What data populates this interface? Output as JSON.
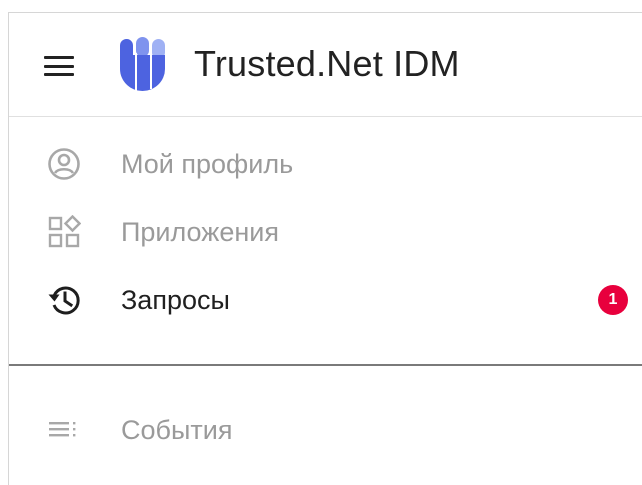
{
  "header": {
    "title": "Trusted.Net IDM",
    "menu_icon": "hamburger-menu-icon",
    "logo": "trusted-net-logo"
  },
  "nav": {
    "items": [
      {
        "label": "Мой профиль",
        "icon": "profile-icon",
        "state": "inactive"
      },
      {
        "label": "Приложения",
        "icon": "apps-icon",
        "state": "inactive"
      },
      {
        "label": "Запросы",
        "icon": "history-icon",
        "state": "active",
        "badge": "1"
      }
    ],
    "secondary_items": [
      {
        "label": "События",
        "icon": "events-list-icon",
        "state": "inactive"
      }
    ]
  },
  "colors": {
    "accent": "#5b6fe0",
    "badge": "#e8003d",
    "active_text": "#202020",
    "muted_text": "#9a9a9a"
  }
}
